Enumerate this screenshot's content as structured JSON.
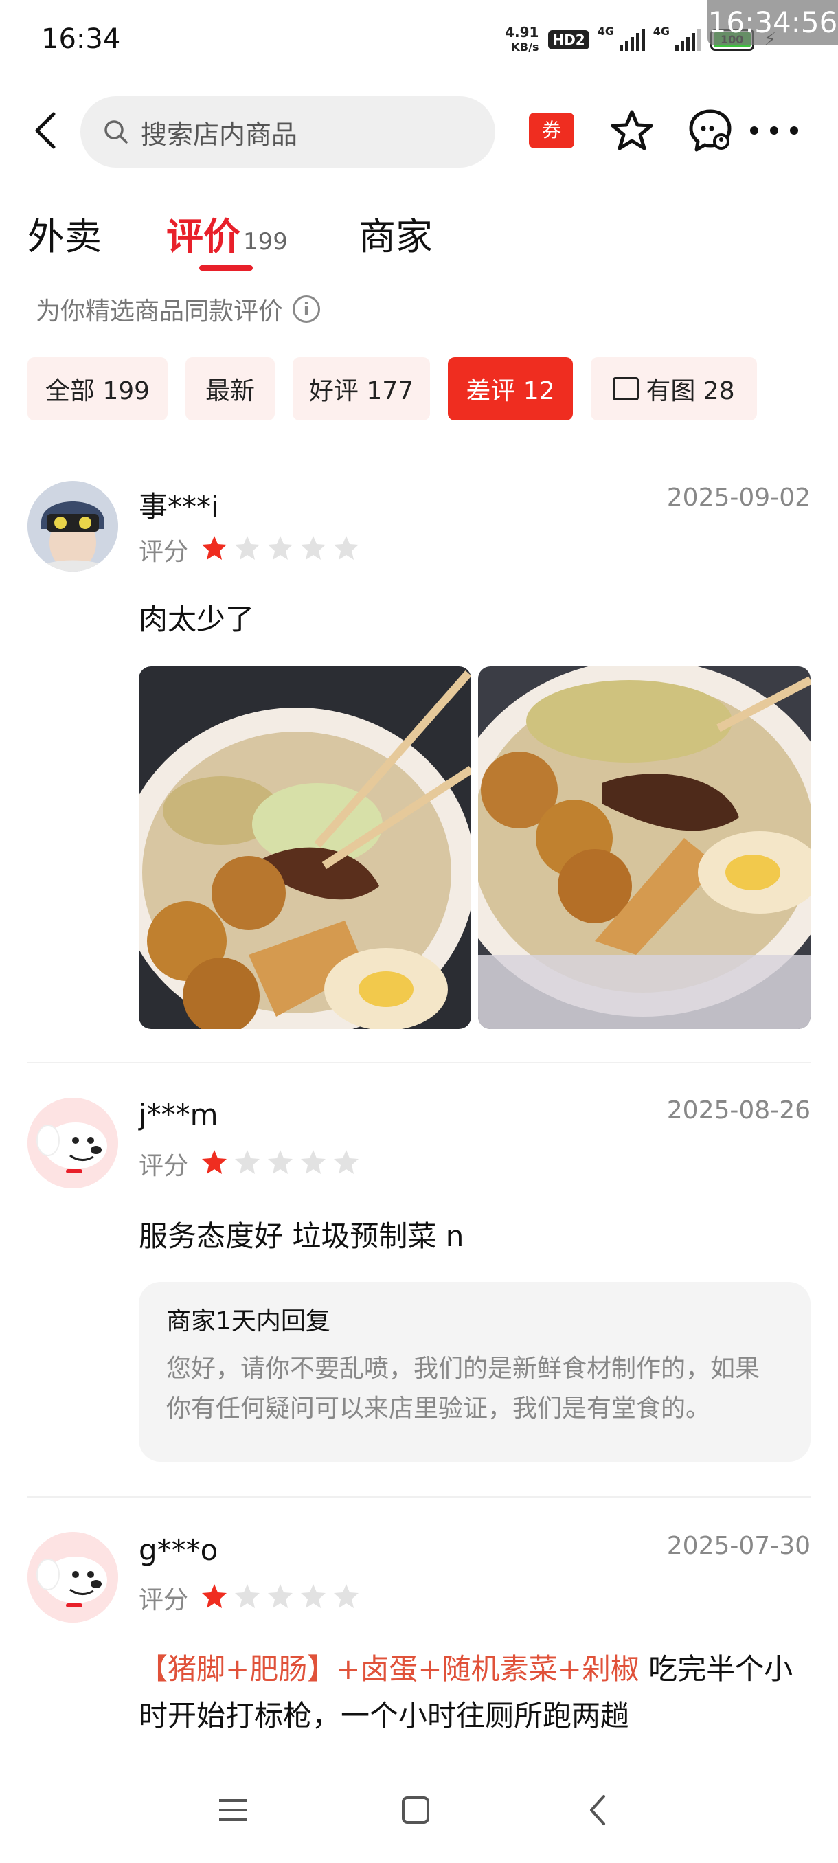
{
  "status_bar": {
    "time": "16:34",
    "net_speed_value": "4.91",
    "net_speed_unit": "KB/s",
    "hd_label": "HD2",
    "signal1_label": "4G",
    "signal2_label": "4G",
    "battery": "100",
    "clock_overlay": "16:34:56"
  },
  "header": {
    "search_placeholder": "搜索店内商品",
    "coupon_label": "券"
  },
  "tabs": [
    {
      "label": "外卖"
    },
    {
      "label": "评价",
      "count": "199"
    },
    {
      "label": "商家"
    }
  ],
  "subtitle": "为你精选商品同款评价",
  "filters": [
    {
      "label": "全部 199"
    },
    {
      "label": "最新"
    },
    {
      "label": "好评 177"
    },
    {
      "label": "差评 12"
    },
    {
      "label": "有图 28"
    }
  ],
  "reviews": [
    {
      "username": "事***i",
      "date": "2025-09-02",
      "rating_label": "评分",
      "rating": 1,
      "text": "肉太少了"
    },
    {
      "username": "j***m",
      "date": "2025-08-26",
      "rating_label": "评分",
      "rating": 1,
      "text": "服务态度好 垃圾预制菜 n",
      "reply_title": "商家1天内回复",
      "reply_body": "您好，请你不要乱喷，我们的是新鲜食材制作的，如果你有任何疑问可以来店里验证，我们是有堂食的。"
    },
    {
      "username": "g***o",
      "date": "2025-07-30",
      "rating_label": "评分",
      "rating": 1,
      "tags": "【猪脚+肥肠】+卤蛋+随机素菜+剁椒",
      "text": " 吃完半个小时开始打标枪，一个小时往厕所跑两趟"
    }
  ],
  "colors": {
    "accent": "#e8202a",
    "chip_active": "#ef2d20",
    "chip_bg": "#fdf0ee",
    "star_filled": "#ef2d20",
    "star_empty": "#e2e2e2"
  }
}
